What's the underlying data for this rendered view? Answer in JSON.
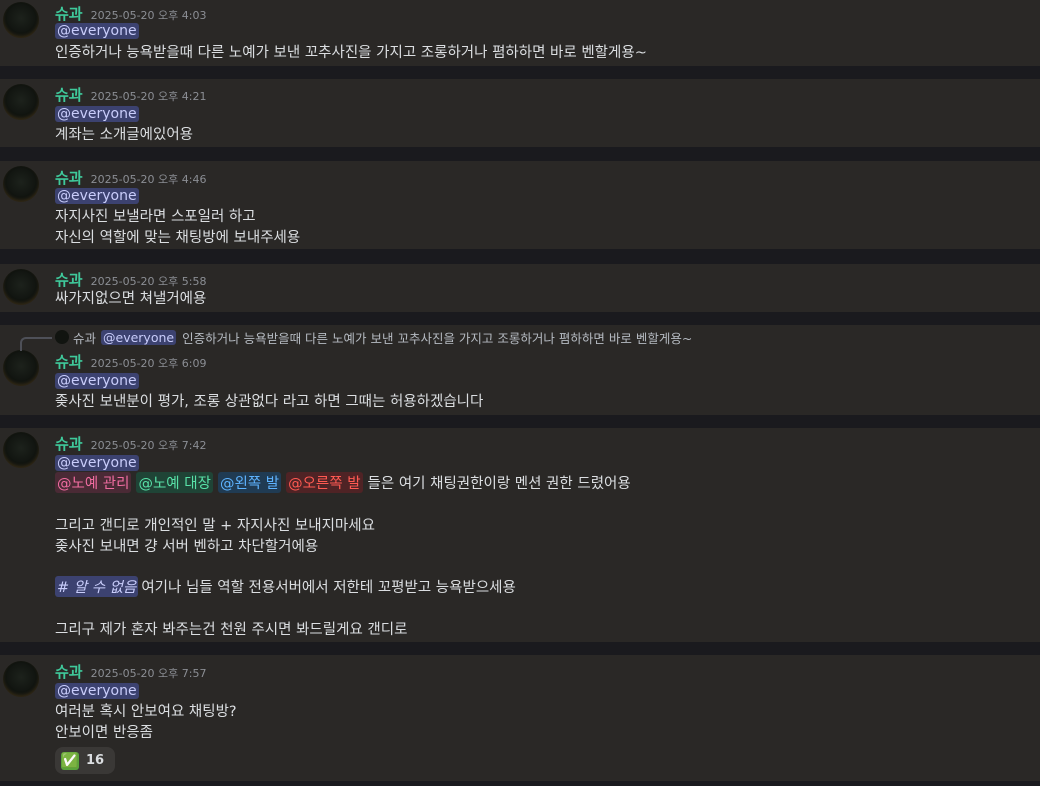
{
  "messages": [
    {
      "author": "슈과",
      "timestamp": "2025-05-20 오후 4:03",
      "mention": "@everyone",
      "lines": [
        "인증하거나 능욕받을때 다른 노예가 보낸 꼬추사진을 가지고 조롱하거나 폄하하면 바로 벤할게용~"
      ]
    },
    {
      "author": "슈과",
      "timestamp": "2025-05-20 오후 4:21",
      "mention": "@everyone",
      "lines": [
        "계좌는 소개글에있어용"
      ]
    },
    {
      "author": "슈과",
      "timestamp": "2025-05-20 오후 4:46",
      "mention": "@everyone",
      "lines": [
        "자지사진 보낼라면 스포일러 하고",
        "자신의 역할에 맞는 채팅방에 보내주세용"
      ]
    },
    {
      "author": "슈과",
      "timestamp": "2025-05-20 오후 5:58",
      "lines": [
        "싸가지없으면 쳐낼거에용"
      ]
    },
    {
      "reply": {
        "author": "슈과",
        "mention": "@everyone",
        "text": "인증하거나 능욕받을때 다른 노예가 보낸 꼬추사진을 가지고 조롱하거나 폄하하면 바로 벤할게용~"
      },
      "author": "슈과",
      "timestamp": "2025-05-20 오후 6:09",
      "mention": "@everyone",
      "lines": [
        "좆사진 보낸분이 평가, 조롱 상관없다 라고 하면 그때는 허용하겠습니다"
      ]
    },
    {
      "author": "슈과",
      "timestamp": "2025-05-20 오후 7:42",
      "mention": "@everyone",
      "role_mentions": [
        "@노예 관리",
        "@노예 대장",
        "@왼쪽 발",
        "@오른쪽 발"
      ],
      "role_line_text": "들은 여기 채팅권한이랑 멘션 권한 드렸어용",
      "lines": [
        "그리고 갠디로 개인적인 말 + 자지사진 보내지마세요",
        "좆사진 보내면 걍 서버 벤하고 차단할거에용"
      ],
      "channel_mention": "# 알 수 없음",
      "channel_line_text": "여기나 님들 역할 전용서버에서 저한테 꼬평받고 능욕받으세용",
      "last_line": "그리구 제가 혼자 봐주는건 천원 주시면 봐드릴게요 갠디로"
    },
    {
      "author": "슈과",
      "timestamp": "2025-05-20 오후 7:57",
      "mention": "@everyone",
      "lines": [
        "여러분 혹시 안보여요 채팅방?",
        "안보이면 반응좀"
      ],
      "reaction": {
        "emoji": "✅",
        "count": "16"
      }
    }
  ],
  "colors": {
    "author": "#3fc99b",
    "mention_bg": "#3c4270",
    "role_pink": "#f06ca0",
    "role_green": "#58e0a7",
    "role_blue": "#5eb3ff",
    "role_red": "#ff5a52"
  }
}
